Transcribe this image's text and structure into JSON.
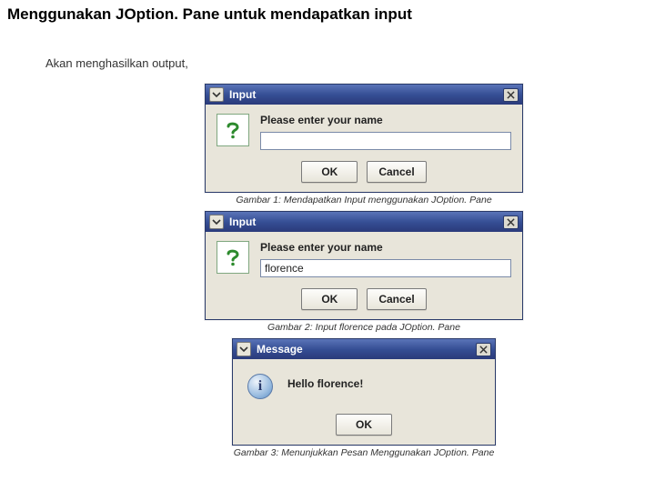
{
  "title": "Menggunakan JOption. Pane untuk mendapatkan input",
  "subheading": "Akan menghasilkan output,",
  "dialogs": {
    "d1": {
      "titlebar": "Input",
      "prompt": "Please enter your name",
      "input_value": "",
      "ok": "OK",
      "cancel": "Cancel",
      "caption": "Gambar 1: Mendapatkan Input menggunakan JOption. Pane"
    },
    "d2": {
      "titlebar": "Input",
      "prompt": "Please enter your name",
      "input_value": "florence",
      "ok": "OK",
      "cancel": "Cancel",
      "caption": "Gambar 2: Input florence pada JOption. Pane"
    },
    "d3": {
      "titlebar": "Message",
      "message": "Hello florence!",
      "ok": "OK",
      "caption": "Gambar 3: Menunjukkan Pesan Menggunakan JOption. Pane"
    }
  },
  "icons": {
    "info_letter": "i"
  }
}
